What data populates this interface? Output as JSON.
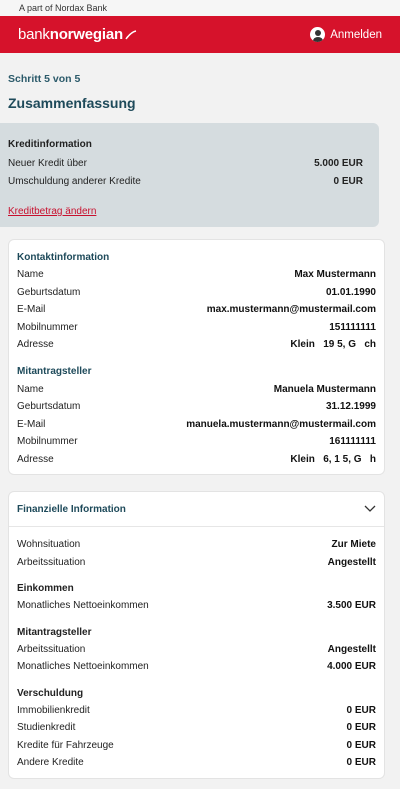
{
  "topbar": {
    "text": "A part of Nordax Bank"
  },
  "header": {
    "logo_bank": "bank",
    "logo_name": "norwegian",
    "login_label": "Anmelden",
    "accent": "#d6122b"
  },
  "step": "Schritt 5 von 5",
  "title": "Zusammenfassung",
  "kredit": {
    "heading": "Kreditinformation",
    "rows": [
      {
        "label": "Neuer Kredit über",
        "value": "5.000 EUR"
      },
      {
        "label": "Umschuldung anderer Kredite",
        "value": "0 EUR"
      }
    ],
    "link": "Kreditbetrag ändern"
  },
  "kontakt": {
    "heading": "Kontaktinformation",
    "rows": [
      {
        "label": "Name",
        "value": "Max Mustermann"
      },
      {
        "label": "Geburtsdatum",
        "value": "01.01.1990"
      },
      {
        "label": "E-Mail",
        "value": "max.mustermann@mustermail.com"
      },
      {
        "label": "Mobilnummer",
        "value": "151111111"
      },
      {
        "label": "Adresse",
        "value": "Klein   19 5, G   ch"
      }
    ],
    "mit_heading": "Mitantragsteller",
    "mit_rows": [
      {
        "label": "Name",
        "value": "Manuela Mustermann"
      },
      {
        "label": "Geburtsdatum",
        "value": "31.12.1999"
      },
      {
        "label": "E-Mail",
        "value": "manuela.mustermann@mustermail.com"
      },
      {
        "label": "Mobilnummer",
        "value": "161111111"
      },
      {
        "label": "Adresse",
        "value": "Klein   6, 1 5, G   h"
      }
    ]
  },
  "finanz": {
    "heading": "Finanzielle Information",
    "rows": [
      {
        "label": "Wohnsituation",
        "value": "Zur Miete"
      },
      {
        "label": "Arbeitssituation",
        "value": "Angestellt"
      }
    ],
    "einkommen_heading": "Einkommen",
    "einkommen_rows": [
      {
        "label": "Monatliches Nettoeinkommen",
        "value": "3.500 EUR"
      }
    ],
    "mit_heading": "Mitantragsteller",
    "mit_rows": [
      {
        "label": "Arbeitssituation",
        "value": "Angestellt"
      },
      {
        "label": "Monatliches Nettoeinkommen",
        "value": "4.000 EUR"
      }
    ],
    "versch_heading": "Verschuldung",
    "versch_rows": [
      {
        "label": "Immobilienkredit",
        "value": "0 EUR"
      },
      {
        "label": "Studienkredit",
        "value": "0 EUR"
      },
      {
        "label": "Kredite für Fahrzeuge",
        "value": "0 EUR"
      },
      {
        "label": "Andere Kredite",
        "value": "0 EUR"
      }
    ]
  }
}
